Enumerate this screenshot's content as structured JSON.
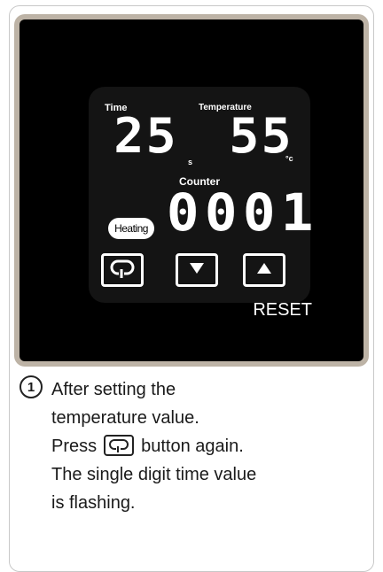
{
  "display": {
    "time_label": "Time",
    "time_value": "25",
    "time_unit": "s",
    "temperature_label": "Temperature",
    "temperature_value": "55",
    "temperature_unit": "°c",
    "counter_label": "Counter",
    "counter_value": "0001",
    "heating_label": "Heating"
  },
  "buttons": {
    "mode_icon": "loop-icon",
    "down_icon": "triangle-down-icon",
    "up_icon": "triangle-up-icon",
    "reset_label": "RESET"
  },
  "instructions": {
    "step_number": "1",
    "line1": "After setting the",
    "line2": "temperature value.",
    "line3_before": "Press",
    "line3_after": "button again.",
    "line4": "The single digit time value",
    "line5": "is flashing."
  }
}
